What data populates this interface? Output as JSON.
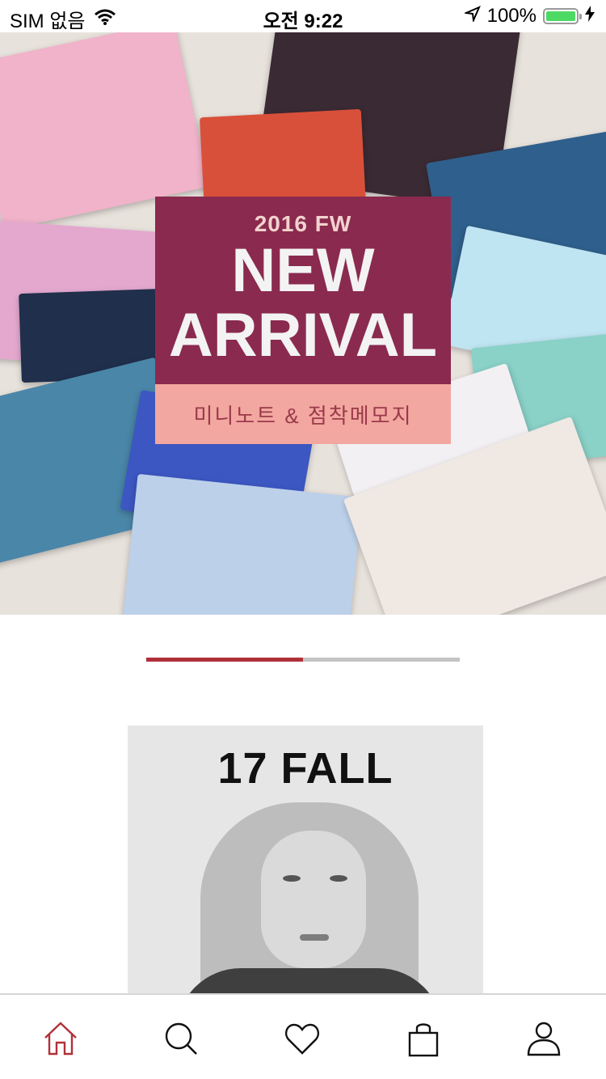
{
  "status_bar": {
    "carrier": "SIM 없음",
    "time": "오전 9:22",
    "battery_percent": "100%",
    "battery_level": 1.0
  },
  "hero_banner": {
    "year_label": "2016 FW",
    "headline_line1": "NEW",
    "headline_line2": "ARRIVAL",
    "subtitle": "미니노트 & 점착메모지"
  },
  "pager": {
    "total_pages": 2,
    "active_index": 0
  },
  "fall_banner": {
    "title": "17 FALL"
  },
  "tab_bar": {
    "tabs": [
      {
        "name": "home",
        "icon": "home-icon",
        "active": true
      },
      {
        "name": "search",
        "icon": "search-icon",
        "active": false
      },
      {
        "name": "wishlist",
        "icon": "heart-icon",
        "active": false
      },
      {
        "name": "cart",
        "icon": "shopping-bag-icon",
        "active": false
      },
      {
        "name": "my-page",
        "icon": "user-icon",
        "active": false
      }
    ],
    "active_color": "#b0303a",
    "inactive_color": "#111111"
  }
}
